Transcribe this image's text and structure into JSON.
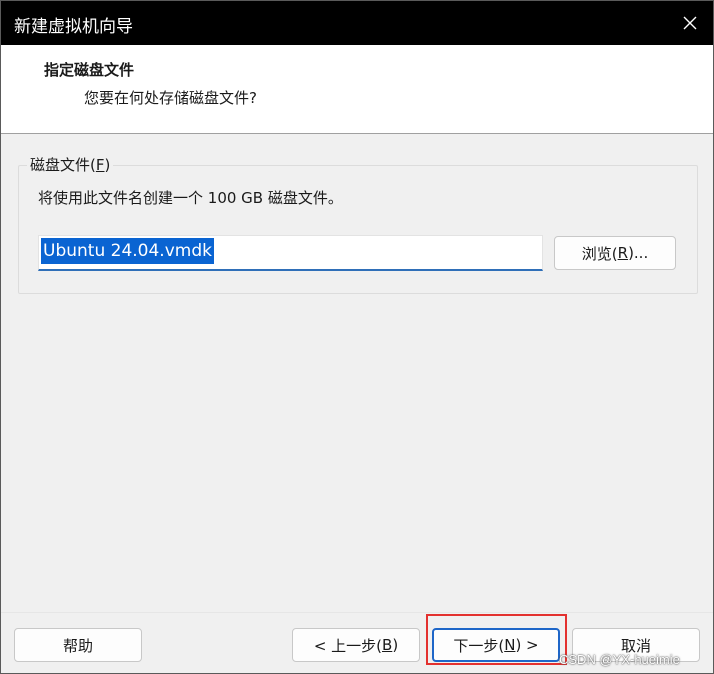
{
  "window": {
    "title": "新建虚拟机向导"
  },
  "header": {
    "title": "指定磁盘文件",
    "subtitle": "您要在何处存储磁盘文件?"
  },
  "group": {
    "legend_prefix": "磁盘文件(",
    "legend_key": "F",
    "legend_suffix": ")",
    "info": "将使用此文件名创建一个 100 GB 磁盘文件。",
    "file_value": "Ubuntu 24.04.vmdk",
    "browse_prefix": "浏览(",
    "browse_key": "R",
    "browse_suffix": ")..."
  },
  "footer": {
    "help_label": "帮助",
    "back_prefix": "< 上一步(",
    "back_key": "B",
    "back_suffix": ")",
    "next_prefix": "下一步(",
    "next_key": "N",
    "next_suffix": ") >",
    "cancel_label": "取消"
  },
  "watermark": "CSDN @YX-hueimie",
  "colors": {
    "accent": "#1e66c8",
    "selection": "#0a64d2",
    "highlight": "#e3312f"
  },
  "icons": {
    "close": "close-icon"
  }
}
